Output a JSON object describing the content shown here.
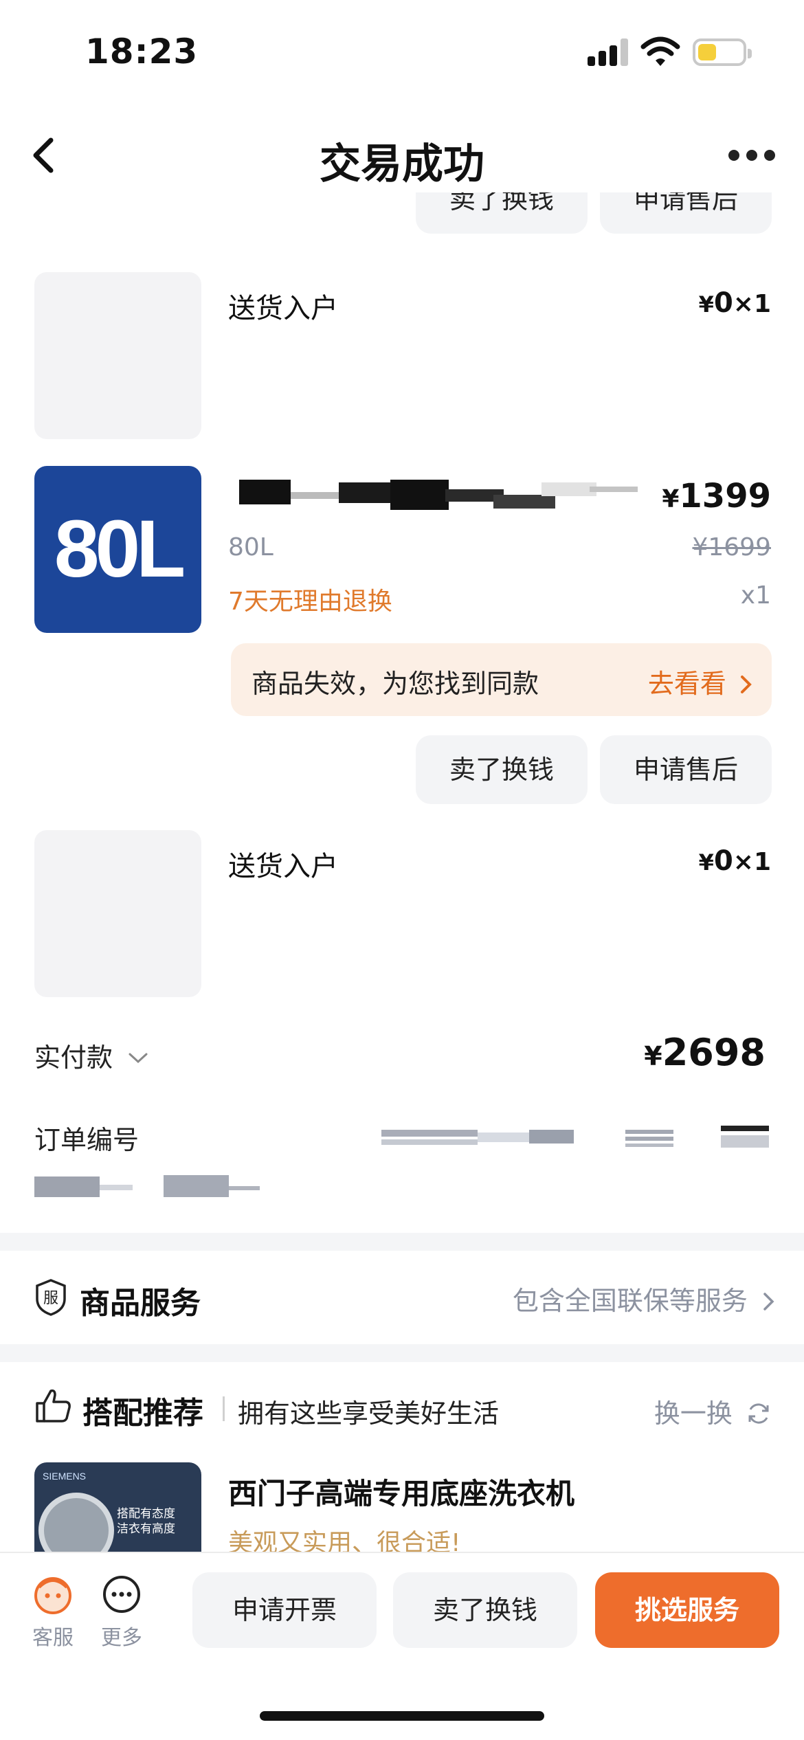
{
  "status_bar": {
    "time": "18:23"
  },
  "nav": {
    "title": "交易成功"
  },
  "top_partial_buttons": {
    "sell": "卖了换钱",
    "after_sale": "申请售后"
  },
  "items": [
    {
      "name": "送货入户",
      "price_symbol": "¥",
      "price": "0",
      "qty": "×1"
    },
    {
      "thumb_text": "80L",
      "spec": "80L",
      "tag": "7天无理由退换",
      "price_symbol": "¥",
      "price": "1399",
      "original_price": "¥1699",
      "qty": "x1",
      "notice": {
        "text": "商品失效，为您找到同款",
        "link": "去看看"
      },
      "buttons": {
        "sell": "卖了换钱",
        "after_sale": "申请售后"
      }
    },
    {
      "name": "送货入户",
      "price_symbol": "¥",
      "price": "0",
      "qty": "×1"
    }
  ],
  "payment": {
    "label": "实付款",
    "symbol": "¥",
    "amount": "2698"
  },
  "order": {
    "label": "订单编号"
  },
  "service": {
    "badge": "服",
    "title": "商品服务",
    "desc": "包含全国联保等服务"
  },
  "recommend": {
    "title": "搭配推荐",
    "subtitle": "拥有这些享受美好生活",
    "refresh": "换一换",
    "product": {
      "brand": "SIEMENS",
      "img_line1": "搭配有态度",
      "img_line2": "洁衣有高度",
      "name": "西门子高端专用底座洗衣机",
      "tagline": "美观又实用、很合适!"
    }
  },
  "bottom_bar": {
    "service_label": "客服",
    "more_label": "更多",
    "invoice": "申请开票",
    "sell": "卖了换钱",
    "choose_service": "挑选服务"
  },
  "colors": {
    "accent": "#ee6d2c",
    "link": "#e26b1d",
    "tag": "#e07a2c",
    "thumb": "#1c4699"
  }
}
